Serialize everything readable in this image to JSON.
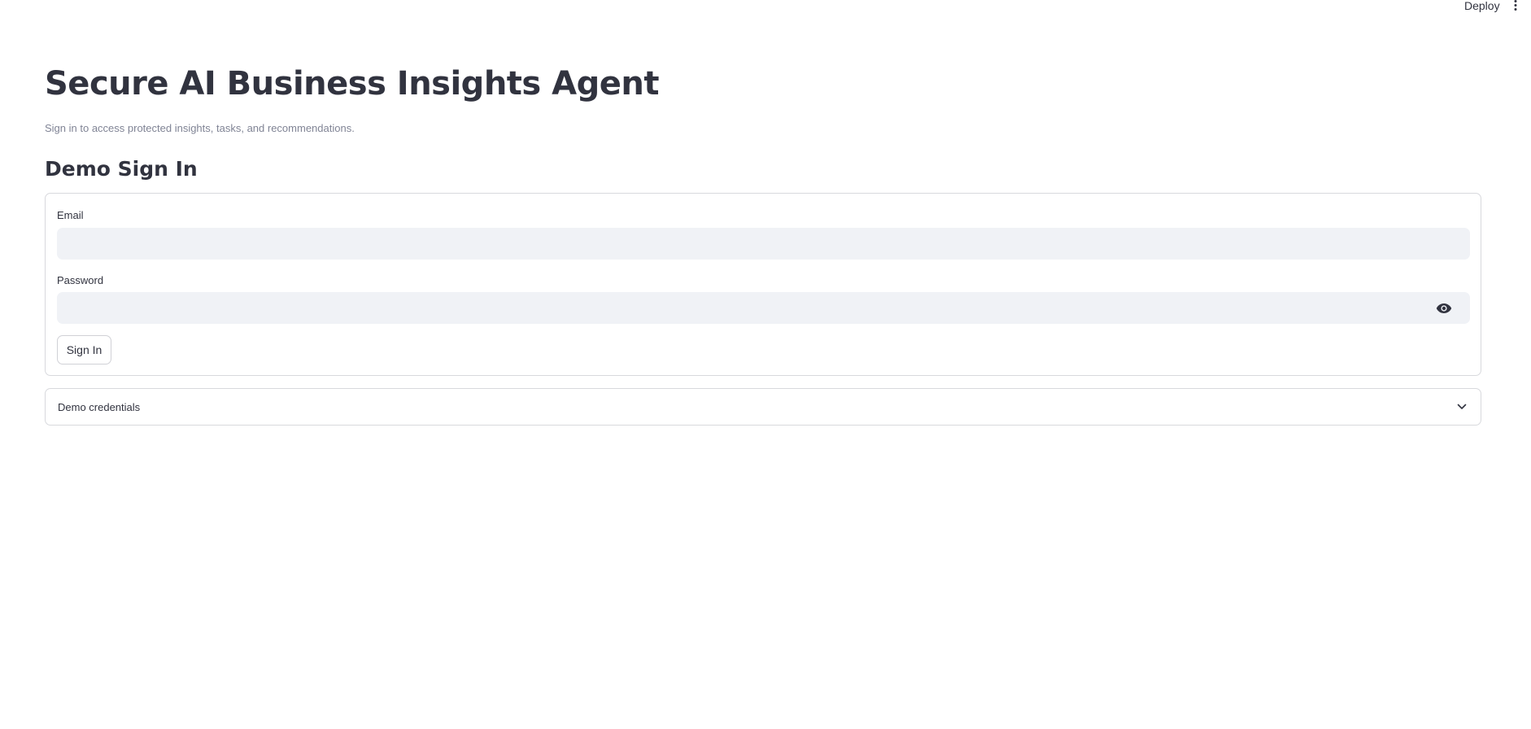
{
  "header": {
    "deploy_label": "Deploy",
    "menu_icon": "vertical-ellipsis-icon"
  },
  "page": {
    "title": "Secure AI Business Insights Agent",
    "subtitle": "Sign in to access protected insights, tasks, and recommendations."
  },
  "signin": {
    "heading": "Demo Sign In",
    "email_label": "Email",
    "email_value": "",
    "password_label": "Password",
    "password_value": "",
    "show_password_icon": "eye-icon",
    "submit_label": "Sign In"
  },
  "demo_credentials": {
    "label": "Demo credentials",
    "expanded": false,
    "icon": "chevron-down-icon"
  },
  "colors": {
    "text": "#31333f",
    "muted": "#808495",
    "input_bg": "#f0f2f6",
    "border": "#d8d9dd"
  }
}
